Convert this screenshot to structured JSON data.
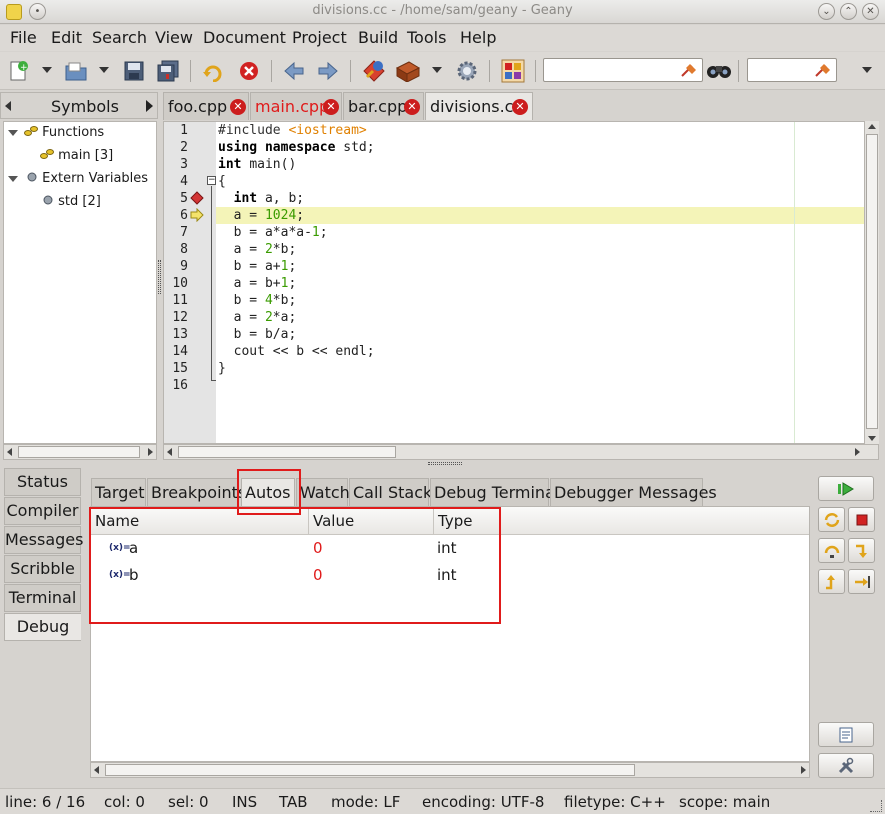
{
  "window": {
    "title": "divisions.cc - /home/sam/geany - Geany"
  },
  "menu": [
    "File",
    "Edit",
    "Search",
    "View",
    "Document",
    "Project",
    "Build",
    "Tools",
    "Help"
  ],
  "sidebar": {
    "tab_label": "Symbols",
    "tree": [
      {
        "label": "Functions",
        "children": [
          {
            "label": "main [3]"
          }
        ]
      },
      {
        "label": "Extern Variables",
        "children": [
          {
            "label": "std [2]"
          }
        ]
      }
    ]
  },
  "tabs": [
    {
      "label": "foo.cpp",
      "modified": false
    },
    {
      "label": "main.cpp",
      "modified": true
    },
    {
      "label": "bar.cpp",
      "modified": false
    },
    {
      "label": "divisions.cc",
      "modified": false,
      "active": true
    }
  ],
  "editor": {
    "lines": [
      "1",
      "2",
      "3",
      "4",
      "5",
      "6",
      "7",
      "8",
      "9",
      "10",
      "11",
      "12",
      "13",
      "14",
      "15",
      "16"
    ],
    "code": [
      {
        "n": "1",
        "parts": [
          {
            "t": "#include ",
            "c": "kw-pre"
          },
          {
            "t": "<iostream>",
            "c": "str"
          }
        ]
      },
      {
        "n": "2",
        "parts": [
          {
            "t": "using ",
            "c": "kw"
          },
          {
            "t": "namespace ",
            "c": "kw"
          },
          {
            "t": "std;",
            "c": ""
          }
        ]
      },
      {
        "n": "3",
        "parts": [
          {
            "t": "int ",
            "c": "kw"
          },
          {
            "t": "main()",
            "c": ""
          }
        ]
      },
      {
        "n": "4",
        "parts": [
          {
            "t": "{",
            "c": ""
          }
        ]
      },
      {
        "n": "5",
        "parts": [
          {
            "t": "  ",
            "c": ""
          },
          {
            "t": "int ",
            "c": "kw"
          },
          {
            "t": "a, b;",
            "c": ""
          }
        ]
      },
      {
        "n": "6",
        "parts": [
          {
            "t": "  a = ",
            "c": ""
          },
          {
            "t": "1024",
            "c": "num"
          },
          {
            "t": ";",
            "c": ""
          }
        ]
      },
      {
        "n": "7",
        "parts": [
          {
            "t": "  b = a*a*a-",
            "c": ""
          },
          {
            "t": "1",
            "c": "num"
          },
          {
            "t": ";",
            "c": ""
          }
        ]
      },
      {
        "n": "8",
        "parts": [
          {
            "t": "  a = ",
            "c": ""
          },
          {
            "t": "2",
            "c": "num"
          },
          {
            "t": "*b;",
            "c": ""
          }
        ]
      },
      {
        "n": "9",
        "parts": [
          {
            "t": "  b = a+",
            "c": ""
          },
          {
            "t": "1",
            "c": "num"
          },
          {
            "t": ";",
            "c": ""
          }
        ]
      },
      {
        "n": "10",
        "parts": [
          {
            "t": "  a = b+",
            "c": ""
          },
          {
            "t": "1",
            "c": "num"
          },
          {
            "t": ";",
            "c": ""
          }
        ]
      },
      {
        "n": "11",
        "parts": [
          {
            "t": "  b = ",
            "c": ""
          },
          {
            "t": "4",
            "c": "num"
          },
          {
            "t": "*b;",
            "c": ""
          }
        ]
      },
      {
        "n": "12",
        "parts": [
          {
            "t": "  a = ",
            "c": ""
          },
          {
            "t": "2",
            "c": "num"
          },
          {
            "t": "*a;",
            "c": ""
          }
        ]
      },
      {
        "n": "13",
        "parts": [
          {
            "t": "  b = b/a;",
            "c": ""
          }
        ]
      },
      {
        "n": "14",
        "parts": [
          {
            "t": "  cout << b << endl;",
            "c": ""
          }
        ]
      },
      {
        "n": "15",
        "parts": [
          {
            "t": "}",
            "c": ""
          }
        ]
      },
      {
        "n": "16",
        "parts": [
          {
            "t": "",
            "c": ""
          }
        ]
      }
    ],
    "breakpoint_line": "5",
    "current_line": "6"
  },
  "message_tabs": [
    "Status",
    "Compiler",
    "Messages",
    "Scribble",
    "Terminal",
    "Debug"
  ],
  "debug_tabs": [
    "Target",
    "Breakpoints",
    "Autos",
    "Watch",
    "Call Stack",
    "Debug Terminal",
    "Debugger Messages"
  ],
  "autos": {
    "columns": [
      "Name",
      "Value",
      "Type"
    ],
    "rows": [
      {
        "icon": "(x)=",
        "name": "a",
        "value": "0",
        "type": "int"
      },
      {
        "icon": "(x)=",
        "name": "b",
        "value": "0",
        "type": "int"
      }
    ]
  },
  "statusbar": {
    "line": "line: 6 / 16",
    "col": "col: 0",
    "sel": "sel: 0",
    "ins": "INS",
    "tab": "TAB",
    "mode": "mode: LF",
    "encoding": "encoding: UTF-8",
    "filetype": "filetype: C++",
    "scope": "scope: main"
  },
  "colors": {
    "modified_tab": "#e01b1b",
    "value_red": "#e01b1b",
    "current_line_highlight": "#f4f4b8",
    "annotation_box": "#e01b1b"
  }
}
